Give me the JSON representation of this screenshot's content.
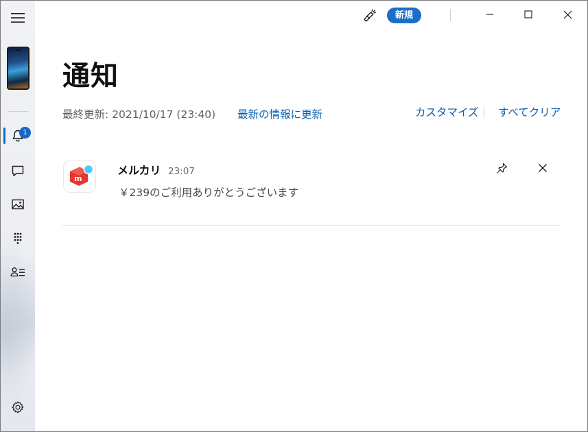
{
  "titlebar": {
    "new_label": "新規",
    "icons": [
      "brush-icon",
      "minimize-icon",
      "maximize-icon",
      "close-icon"
    ]
  },
  "sidebar": {
    "items": [
      {
        "name": "menu",
        "icon": "hamburger-icon"
      },
      {
        "name": "phone",
        "icon": "phone-thumbnail"
      },
      {
        "name": "notifications",
        "icon": "bell-icon",
        "badge": "1",
        "active": true
      },
      {
        "name": "messages",
        "icon": "chat-icon"
      },
      {
        "name": "photos",
        "icon": "photo-icon"
      },
      {
        "name": "calls",
        "icon": "dialpad-icon"
      },
      {
        "name": "contacts",
        "icon": "contacts-icon"
      },
      {
        "name": "settings",
        "icon": "gear-icon"
      }
    ]
  },
  "main": {
    "title": "通知",
    "last_updated": "最終更新: 2021/10/17 (23:40)",
    "refresh_label": "最新の情報に更新",
    "customize_label": "カスタマイズ",
    "clear_all_label": "すべてクリア"
  },
  "notifications": [
    {
      "app": "メルカリ",
      "time": "23:07",
      "body": "￥239のご利用ありがとうございます",
      "icon": "mercari-icon"
    }
  ],
  "colors": {
    "accent": "#0a5fb4",
    "badge": "#1666c5",
    "mercari_red": "#ea352d",
    "mercari_dot": "#4dc9ff"
  }
}
